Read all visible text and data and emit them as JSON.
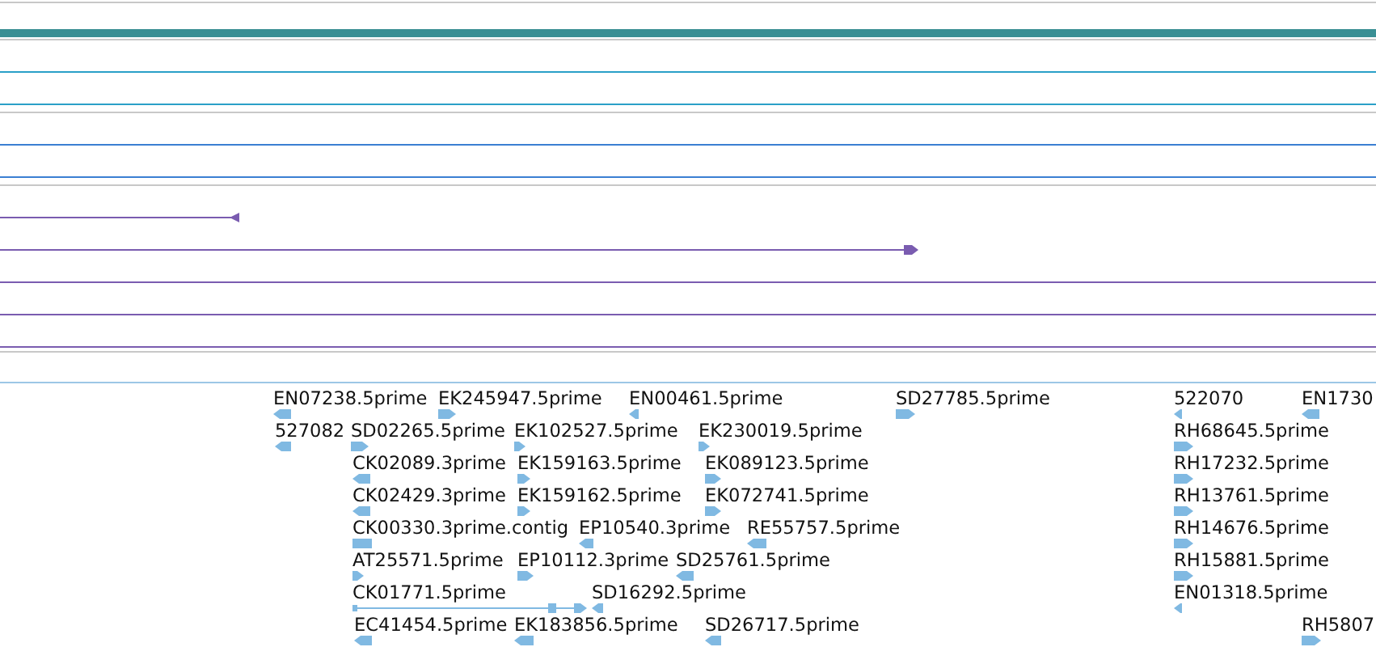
{
  "track_groups": [
    {
      "tracks": [
        {
          "kind": "bar",
          "color": "#3a8f94"
        }
      ]
    },
    {
      "tracks": [
        {
          "kind": "line",
          "color": "#2aa0c8"
        },
        {
          "kind": "line",
          "color": "#2aa0c8"
        }
      ]
    },
    {
      "tracks": [
        {
          "kind": "line",
          "color": "#3b7fd2"
        },
        {
          "kind": "line",
          "color": "#3b7fd2"
        }
      ]
    },
    {
      "tracks": [
        {
          "kind": "reverse",
          "color": "#7a5cb0"
        },
        {
          "kind": "forward",
          "color": "#7a5cb0"
        },
        {
          "kind": "line",
          "color": "#7a5cb0"
        },
        {
          "kind": "line",
          "color": "#7a5cb0"
        },
        {
          "kind": "line",
          "color": "#7a5cb0"
        }
      ]
    }
  ],
  "feature_rows": [
    {
      "features": [
        {
          "label": "EN07238.5prime",
          "kind": "reverse"
        },
        {
          "label": "EK245947.5prime",
          "kind": "forward"
        },
        {
          "label": "EN00461.5prime",
          "kind": "reverse"
        },
        {
          "label": "SD27785.5prime",
          "kind": "forward"
        },
        {
          "label": "522070",
          "kind": "reverse"
        },
        {
          "label": "EN1730",
          "kind": "reverse"
        }
      ]
    },
    {
      "features": [
        {
          "label": "527082",
          "kind": "reverse"
        },
        {
          "label": "SD02265.5prime",
          "kind": "forward"
        },
        {
          "label": "EK102527.5prime",
          "kind": "forward"
        },
        {
          "label": "EK230019.5prime",
          "kind": "forward"
        },
        {
          "label": "RH68645.5prime",
          "kind": "forward"
        }
      ]
    },
    {
      "features": [
        {
          "label": "CK02089.3prime",
          "kind": "reverse"
        },
        {
          "label": "EK159163.5prime",
          "kind": "forward"
        },
        {
          "label": "EK089123.5prime",
          "kind": "forward"
        },
        {
          "label": "RH17232.5prime",
          "kind": "forward"
        }
      ]
    },
    {
      "features": [
        {
          "label": "CK02429.3prime",
          "kind": "reverse"
        },
        {
          "label": "EK159162.5prime",
          "kind": "forward"
        },
        {
          "label": "EK072741.5prime",
          "kind": "forward"
        },
        {
          "label": "RH13761.5prime",
          "kind": "forward"
        }
      ]
    },
    {
      "features": [
        {
          "label": "CK00330.3prime.contig",
          "kind": "block"
        },
        {
          "label": "EP10540.3prime",
          "kind": "reverse"
        },
        {
          "label": "RE55757.5prime",
          "kind": "reverse"
        },
        {
          "label": "RH14676.5prime",
          "kind": "forward"
        }
      ]
    },
    {
      "features": [
        {
          "label": "AT25571.5prime",
          "kind": "forward"
        },
        {
          "label": "EP10112.3prime",
          "kind": "forward"
        },
        {
          "label": "SD25761.5prime",
          "kind": "reverse"
        },
        {
          "label": "RH15881.5prime",
          "kind": "forward"
        }
      ]
    },
    {
      "features": [
        {
          "label": "CK01771.5prime",
          "kind": "forward"
        },
        {
          "label": "SD16292.5prime",
          "kind": "reverse"
        },
        {
          "label": "EN01318.5prime",
          "kind": "reverse"
        }
      ]
    },
    {
      "features": [
        {
          "label": "EC41454.5prime",
          "kind": "reverse"
        },
        {
          "label": "EK183856.5prime",
          "kind": "reverse"
        },
        {
          "label": "SD26717.5prime",
          "kind": "reverse"
        },
        {
          "label": "RH5807",
          "kind": "forward"
        }
      ]
    }
  ]
}
